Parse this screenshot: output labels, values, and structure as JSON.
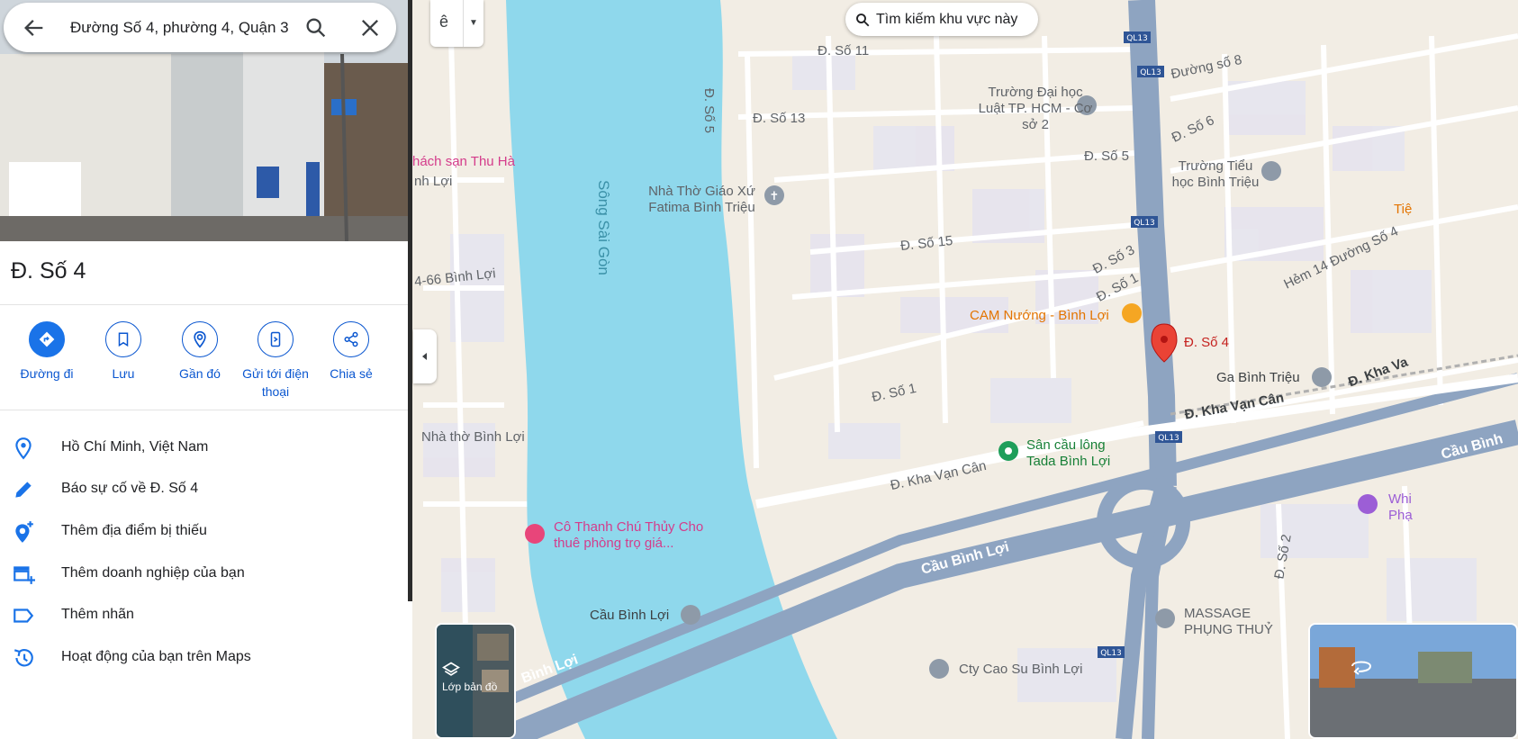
{
  "search": {
    "query": "Đường Số 4, phường 4, Quận 3"
  },
  "place": {
    "title": "Đ. Số 4",
    "actions": [
      {
        "label": "Đường đi",
        "icon": "directions-icon"
      },
      {
        "label": "Lưu",
        "icon": "bookmark-icon"
      },
      {
        "label": "Gần đó",
        "icon": "nearby-icon"
      },
      {
        "label": "Gửi tới điện thoại",
        "icon": "send-to-phone-icon"
      },
      {
        "label": "Chia sẻ",
        "icon": "share-icon"
      }
    ],
    "menu": [
      {
        "label": "Hồ Chí Minh, Việt Nam",
        "icon": "location-pin-icon"
      },
      {
        "label": "Báo sự cố về Đ. Số 4",
        "icon": "pencil-icon"
      },
      {
        "label": "Thêm địa điểm bị thiếu",
        "icon": "add-place-icon"
      },
      {
        "label": "Thêm doanh nghiệp của bạn",
        "icon": "add-business-icon"
      },
      {
        "label": "Thêm nhãn",
        "icon": "label-icon"
      },
      {
        "label": "Hoạt động của bạn trên Maps",
        "icon": "history-icon"
      }
    ]
  },
  "map": {
    "search_this_area": "Tìm kiếm khu vực này",
    "keyboard_button": "ê",
    "layers_label": "Lớp bản đồ",
    "river": "Sông Sài Gòn",
    "labels": {
      "d_so_11": "Đ. Số 11",
      "d_so_5_v": "Đ. Số 5",
      "d_so_13": "Đ. Số 13",
      "d_so_5": "Đ. Số 5",
      "d_so_15": "Đ. Số 15",
      "d_so_3": "Đ. Số 3",
      "d_so_1": "Đ. Số 1",
      "d_so_1_b": "Đ. Số 1",
      "d_so_2": "Đ. Số 2",
      "duong_so_8": "Đường số 8",
      "d_so_6": "Đ. Số 6",
      "hem_14": "Hẻm 14 Đường Số 4",
      "kha_van_can": "Đ. Kha Vạn Cân",
      "kha_van_can_2": "Đ. Kha Vạn Cân",
      "kha_van_can_3": "Đ. Kha Va",
      "cau_binh_loi": "Cầu Bình Lợi",
      "cau_binh_loi_2": "Cầu Bình",
      "binh_loi": "Bình Lợi",
      "binh_loi_2": "nh Lợi",
      "binh_loi_66": "4-66 Bình Lợi",
      "ql13": "QL13"
    },
    "pois": {
      "truong_luat": "Trường Đại học Luật TP. HCM - Cơ sở 2",
      "truong_tieu_hoc": "Trường Tiểu học Bình Triệu",
      "nha_tho_fatima": "Nhà Thờ Giáo Xứ Fatima Bình Triệu",
      "khach_san": "hách sạn Thu Hà",
      "cam_nuong": "CAM Nướng - Bình Lợi",
      "selected_pin": "Đ. Số 4",
      "ga_binh_trieu": "Ga Bình Triệu",
      "san_cau_long": "Sân cầu lông Tada Bình Lợi",
      "nha_tho_binh_loi": "Nhà thờ Bình Lợi",
      "co_thanh": "Cô Thanh Chú Thủy Cho thuê phòng trọ giá...",
      "cau_binh_loi_poi": "Cầu Bình Lợi",
      "massage": "MASSAGE PHỤNG THUỶ",
      "cty_cao_su": "Cty Cao Su Bình Lợi",
      "edge_tie": "Tiệ",
      "edge_whi": "Whi Phạ"
    },
    "colors": {
      "land": "#f2ede4",
      "water": "#8fd8ec",
      "highway": "#8ea4c1",
      "road": "#ffffff",
      "pin": "#ea4335",
      "accent": "#1a73e8"
    }
  }
}
